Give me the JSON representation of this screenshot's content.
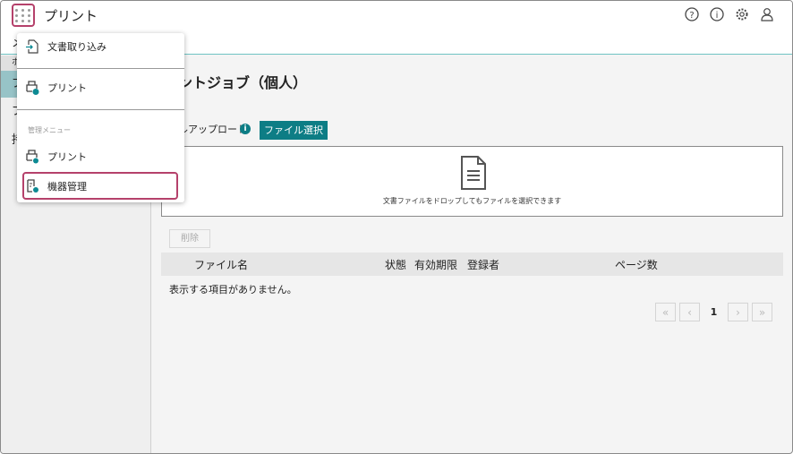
{
  "header": {
    "title": "プリント",
    "icons": [
      "apps-grid-icon",
      "help-icon",
      "info-icon",
      "settings-icon",
      "user-icon"
    ]
  },
  "sidebar": {
    "fragments": [
      "メ",
      "ホ",
      "プ",
      "プ",
      "持"
    ],
    "accent": "#97c3c7"
  },
  "main": {
    "page_title": "ントジョブ（個人）",
    "upload_label": "ルアップロード",
    "info_glyph": "i",
    "file_select": "ファイル選択",
    "drop_message": "文書ファイルをドロップしてもファイルを選択できます",
    "delete": "削除",
    "columns": [
      "ファイル名",
      "状態",
      "有効期限",
      "登録者",
      "ページ数"
    ],
    "empty_message": "表示する項目がありません。",
    "pager": {
      "first": "«",
      "prev": "‹",
      "current": "1",
      "next": "›",
      "last": "»"
    }
  },
  "menu": {
    "items": [
      {
        "label": "文書取り込み"
      },
      {
        "label": "プリント"
      }
    ],
    "admin_header": "管理メニュー",
    "admin_items": [
      {
        "label": "プリント"
      },
      {
        "label": "機器管理"
      }
    ]
  },
  "colors": {
    "teal": "#0d7d85",
    "highlight": "#b5416b"
  }
}
